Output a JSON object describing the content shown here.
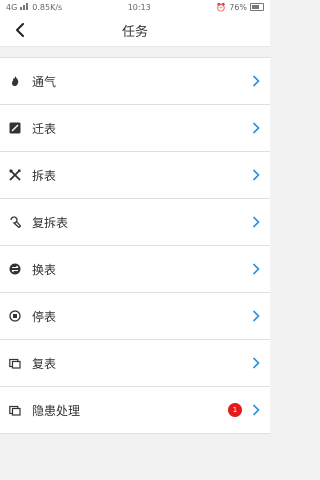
{
  "status": {
    "signal": "4G",
    "speed": "0.85K/s",
    "time": "10:13",
    "battery": "76%"
  },
  "header": {
    "title": "任务"
  },
  "items": [
    {
      "label": "通气",
      "icon": "flame-icon"
    },
    {
      "label": "迁表",
      "icon": "edit-square-icon"
    },
    {
      "label": "拆表",
      "icon": "tools-icon"
    },
    {
      "label": "复拆表",
      "icon": "wrench-icon"
    },
    {
      "label": "换表",
      "icon": "swap-icon"
    },
    {
      "label": "停表",
      "icon": "stop-icon"
    },
    {
      "label": "复表",
      "icon": "copy-icon"
    },
    {
      "label": "隐患处理",
      "icon": "copy-icon",
      "badge": "1"
    }
  ],
  "colors": {
    "chevron": "#2b8fd6",
    "badge": "#e21a1a"
  }
}
